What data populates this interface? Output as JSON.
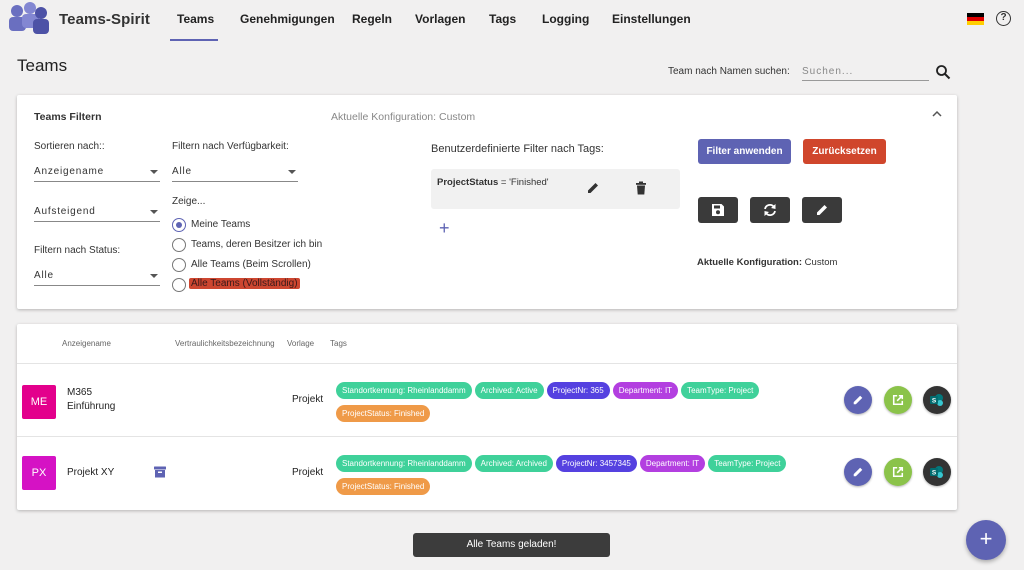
{
  "app": {
    "title": "Teams-Spirit"
  },
  "nav": {
    "items": [
      {
        "label": "Teams",
        "active": true
      },
      {
        "label": "Genehmigungen"
      },
      {
        "label": "Regeln"
      },
      {
        "label": "Vorlagen"
      },
      {
        "label": "Tags"
      },
      {
        "label": "Logging"
      },
      {
        "label": "Einstellungen"
      }
    ],
    "language_flag": "de-flag-icon",
    "help_icon": "?"
  },
  "page": {
    "title": "Teams",
    "search_label": "Team nach Namen suchen:",
    "search_placeholder": "Suchen..."
  },
  "filter": {
    "title": "Teams Filtern",
    "config_header": "Aktuelle Konfiguration: Custom",
    "sort_label": "Sortieren nach::",
    "sort_value": "Anzeigename",
    "order_value": "Aufsteigend",
    "status_label": "Filtern nach Status:",
    "status_value": "Alle",
    "availability_label": "Filtern nach Verfügbarkeit:",
    "availability_value": "Alle",
    "show_label": "Zeige...",
    "show_options": [
      {
        "label": "Meine Teams",
        "selected": true
      },
      {
        "label": "Teams, deren Besitzer ich bin",
        "selected": false
      },
      {
        "label": "Alle Teams (Beim Scrollen)",
        "selected": false
      },
      {
        "label": "Alle Teams (Vollständig)",
        "selected": false,
        "highlighted": true
      }
    ],
    "tag_filter_title": "Benutzerdefinierte Filter nach Tags:",
    "tag_filter": {
      "key": "ProjectStatus",
      "expr": " = 'Finished'"
    },
    "add_symbol": "+",
    "apply_button": "Filter anwenden",
    "reset_button": "Zurücksetzen",
    "current_config_label": "Aktuelle Konfiguration:",
    "current_config_value": " Custom"
  },
  "table": {
    "columns": [
      "Anzeigename",
      "Vertraulichkeitsbezeichnung",
      "Vorlage",
      "Tags"
    ],
    "rows": [
      {
        "initials": "ME",
        "tile_color": "#e3008c",
        "name_line1": "M365",
        "name_line2": "Einführung",
        "archived": false,
        "vorlage": "Projekt",
        "tags": [
          {
            "text": "Standortkennung: Rheinlanddamm",
            "color": "#3fd19a"
          },
          {
            "text": "Archived: Active",
            "color": "#3fd19a"
          },
          {
            "text": "ProjectNr: 365",
            "color": "#5541e0"
          },
          {
            "text": "Department: IT",
            "color": "#b33fe0"
          },
          {
            "text": "TeamType: Project",
            "color": "#3fd19a"
          },
          {
            "text": "ProjectStatus: Finished",
            "color": "#ef9a48"
          }
        ]
      },
      {
        "initials": "PX",
        "tile_color": "#d512c4",
        "name_line1": "Projekt XY",
        "name_line2": "",
        "archived": true,
        "vorlage": "Projekt",
        "tags": [
          {
            "text": "Standortkennung: Rheinlanddamm",
            "color": "#3fd19a"
          },
          {
            "text": "Archived: Archived",
            "color": "#3fd19a"
          },
          {
            "text": "ProjectNr: 3457345",
            "color": "#5541e0"
          },
          {
            "text": "Department: IT",
            "color": "#b33fe0"
          },
          {
            "text": "TeamType: Project",
            "color": "#3fd19a"
          },
          {
            "text": "ProjectStatus: Finished",
            "color": "#ef9a48"
          }
        ]
      }
    ]
  },
  "toast": "Alle Teams geladen!",
  "fab": "+",
  "colors": {
    "primary": "#5e63b3",
    "danger": "#d0462c",
    "open_action": "#8bc34a",
    "dark_action": "#3a3a3a"
  }
}
